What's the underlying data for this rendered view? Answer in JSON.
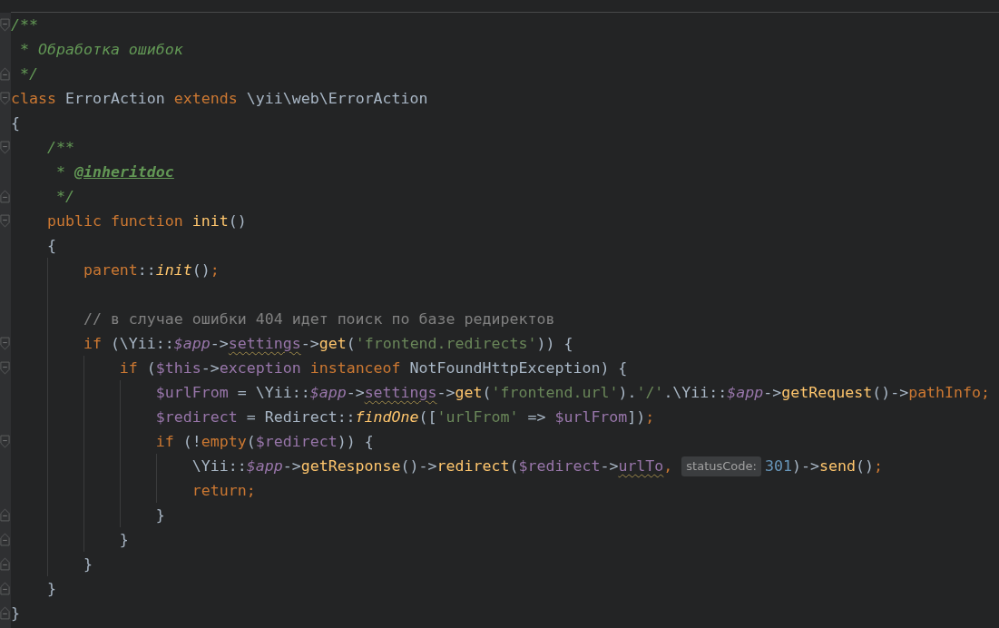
{
  "editor": {
    "lines": [
      {
        "fold_start": true,
        "tokens": [
          {
            "text": "/**",
            "kind": "doc"
          }
        ]
      },
      {
        "tokens": [
          {
            "text": " * Обработка ошибок",
            "kind": "doc"
          }
        ]
      },
      {
        "fold_end": true,
        "tokens": [
          {
            "text": " */",
            "kind": "doc"
          }
        ]
      },
      {
        "fold_start": true,
        "tokens": [
          {
            "text": "class",
            "kind": "keyword"
          },
          {
            "text": " ErrorAction ",
            "kind": "plain"
          },
          {
            "text": "extends",
            "kind": "keyword"
          },
          {
            "text": " \\yii\\web\\ErrorAction",
            "kind": "plain"
          }
        ]
      },
      {
        "tokens": [
          {
            "text": "{",
            "kind": "plain"
          }
        ]
      },
      {
        "fold_start": true,
        "tokens": [
          {
            "text": "    /**",
            "kind": "doc"
          }
        ]
      },
      {
        "tokens": [
          {
            "text": "     * ",
            "kind": "doc"
          },
          {
            "text": "@inheritdoc",
            "kind": "doctag"
          }
        ]
      },
      {
        "fold_end": true,
        "tokens": [
          {
            "text": "     */",
            "kind": "doc"
          }
        ]
      },
      {
        "fold_start": true,
        "tokens": [
          {
            "text": "    public function",
            "kind": "keyword"
          },
          {
            "text": " init",
            "kind": "func"
          },
          {
            "text": "()",
            "kind": "plain"
          }
        ]
      },
      {
        "tokens": [
          {
            "text": "    {",
            "kind": "plain"
          }
        ]
      },
      {
        "tokens": [
          {
            "text": "        parent",
            "kind": "keyword"
          },
          {
            "text": "::",
            "kind": "plain"
          },
          {
            "text": "init",
            "kind": "staticfunc"
          },
          {
            "text": "()",
            "kind": "plain"
          },
          {
            "text": ";",
            "kind": "keyword"
          }
        ]
      },
      {
        "blank_line_before": true,
        "tokens": [
          {
            "text": "        // в случае ошибки 404 идет поиск по базе редиректов",
            "kind": "comment"
          }
        ]
      },
      {
        "fold_start": true,
        "tokens": [
          {
            "text": "        if",
            "kind": "keyword"
          },
          {
            "text": " (\\Yii::",
            "kind": "plain"
          },
          {
            "text": "$app",
            "kind": "staticvar"
          },
          {
            "text": "->",
            "kind": "plain"
          },
          {
            "text": "settings",
            "kind": "var",
            "warning": true
          },
          {
            "text": "->",
            "kind": "plain"
          },
          {
            "text": "get",
            "kind": "func"
          },
          {
            "text": "(",
            "kind": "plain"
          },
          {
            "text": "'frontend.redirects'",
            "kind": "string"
          },
          {
            "text": ")) {",
            "kind": "plain"
          }
        ]
      },
      {
        "fold_start": true,
        "tokens": [
          {
            "text": "            if",
            "kind": "keyword"
          },
          {
            "text": " (",
            "kind": "plain"
          },
          {
            "text": "$this",
            "kind": "var"
          },
          {
            "text": "->",
            "kind": "plain"
          },
          {
            "text": "exception",
            "kind": "var"
          },
          {
            "text": " instanceof",
            "kind": "keyword"
          },
          {
            "text": " NotFoundHttpException) {",
            "kind": "plain"
          }
        ]
      },
      {
        "tokens": [
          {
            "text": "                $urlFrom",
            "kind": "var"
          },
          {
            "text": " = \\Yii::",
            "kind": "plain"
          },
          {
            "text": "$app",
            "kind": "staticvar"
          },
          {
            "text": "->",
            "kind": "plain"
          },
          {
            "text": "settings",
            "kind": "var",
            "warning": true
          },
          {
            "text": "->",
            "kind": "plain"
          },
          {
            "text": "get",
            "kind": "func"
          },
          {
            "text": "(",
            "kind": "plain"
          },
          {
            "text": "'frontend.url'",
            "kind": "string"
          },
          {
            "text": ").",
            "kind": "plain"
          },
          {
            "text": "'/'",
            "kind": "string"
          },
          {
            "text": ".\\Yii::",
            "kind": "plain"
          },
          {
            "text": "$app",
            "kind": "staticvar"
          },
          {
            "text": "->",
            "kind": "plain"
          },
          {
            "text": "getRequest",
            "kind": "func"
          },
          {
            "text": "()->",
            "kind": "plain"
          },
          {
            "text": "pathInfo",
            "kind": "field"
          },
          {
            "text": ";",
            "kind": "keyword"
          }
        ]
      },
      {
        "tokens": [
          {
            "text": "                $redirect",
            "kind": "var"
          },
          {
            "text": " = Redirect::",
            "kind": "plain"
          },
          {
            "text": "findOne",
            "kind": "staticfunc"
          },
          {
            "text": "([",
            "kind": "plain"
          },
          {
            "text": "'urlFrom'",
            "kind": "string"
          },
          {
            "text": " => ",
            "kind": "plain"
          },
          {
            "text": "$urlFrom",
            "kind": "var"
          },
          {
            "text": "])",
            "kind": "plain"
          },
          {
            "text": ";",
            "kind": "keyword"
          }
        ]
      },
      {
        "fold_start": true,
        "tokens": [
          {
            "text": "                if",
            "kind": "keyword"
          },
          {
            "text": " (!",
            "kind": "plain"
          },
          {
            "text": "empty",
            "kind": "keyword"
          },
          {
            "text": "(",
            "kind": "plain"
          },
          {
            "text": "$redirect",
            "kind": "var"
          },
          {
            "text": ")) {",
            "kind": "plain"
          }
        ]
      },
      {
        "tokens": [
          {
            "text": "                    \\Yii::",
            "kind": "plain"
          },
          {
            "text": "$app",
            "kind": "staticvar"
          },
          {
            "text": "->",
            "kind": "plain"
          },
          {
            "text": "getResponse",
            "kind": "func"
          },
          {
            "text": "()->",
            "kind": "plain"
          },
          {
            "text": "redirect",
            "kind": "func"
          },
          {
            "text": "(",
            "kind": "plain"
          },
          {
            "text": "$redirect",
            "kind": "var"
          },
          {
            "text": "->",
            "kind": "plain"
          },
          {
            "text": "urlTo",
            "kind": "var",
            "warning": true
          },
          {
            "text": ",",
            "kind": "keyword"
          },
          {
            "text": "statusCode:",
            "kind": "hint"
          },
          {
            "text": "301",
            "kind": "number"
          },
          {
            "text": ")->",
            "kind": "plain"
          },
          {
            "text": "send",
            "kind": "func"
          },
          {
            "text": "()",
            "kind": "plain"
          },
          {
            "text": ";",
            "kind": "keyword"
          }
        ]
      },
      {
        "tokens": [
          {
            "text": "                    return",
            "kind": "keyword"
          },
          {
            "text": ";",
            "kind": "keyword"
          }
        ]
      },
      {
        "fold_end": true,
        "tokens": [
          {
            "text": "                }",
            "kind": "plain"
          }
        ]
      },
      {
        "fold_end": true,
        "tokens": [
          {
            "text": "            }",
            "kind": "plain"
          }
        ]
      },
      {
        "fold_end": true,
        "tokens": [
          {
            "text": "        }",
            "kind": "plain"
          }
        ]
      },
      {
        "fold_end": true,
        "tokens": [
          {
            "text": "    }",
            "kind": "plain"
          }
        ]
      },
      {
        "fold_end": true,
        "tokens": [
          {
            "text": "}",
            "kind": "plain"
          }
        ]
      }
    ]
  }
}
